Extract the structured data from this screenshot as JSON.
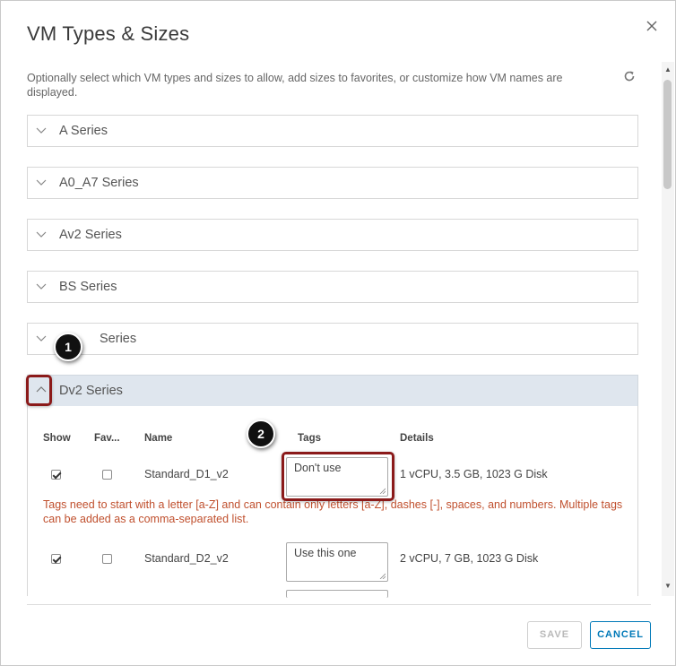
{
  "dialog": {
    "title": "VM Types & Sizes",
    "description": "Optionally select which VM types and sizes to allow, add sizes to favorites, or customize how VM names are displayed.",
    "close_icon": "close-icon",
    "refresh_icon": "refresh-icon"
  },
  "series": [
    {
      "label": "A Series",
      "expanded": false
    },
    {
      "label": "A0_A7 Series",
      "expanded": false
    },
    {
      "label": "Av2 Series",
      "expanded": false
    },
    {
      "label": "BS Series",
      "expanded": false
    },
    {
      "label": "Series",
      "expanded": false
    },
    {
      "label": "Dv2 Series",
      "expanded": true
    }
  ],
  "table": {
    "headers": {
      "show": "Show",
      "fav": "Fav...",
      "name": "Name",
      "tags": "Tags",
      "details": "Details"
    },
    "rows": [
      {
        "show": true,
        "fav": false,
        "name": "Standard_D1_v2",
        "tags": "Don't use",
        "details": "1 vCPU, 3.5 GB, 1023 G Disk"
      },
      {
        "show": true,
        "fav": false,
        "name": "Standard_D2_v2",
        "tags": "Use this one",
        "details": "2 vCPU, 7 GB, 1023 G Disk"
      }
    ],
    "error": "Tags need to start with a letter [a-Z] and can contain only letters [a-Z], dashes [-], spaces, and numbers. Multiple tags can be added as a comma-separated list."
  },
  "callouts": {
    "one": "1",
    "two": "2"
  },
  "footer": {
    "save_label": "SAVE",
    "cancel_label": "CANCEL"
  },
  "colors": {
    "accent": "#0079b8",
    "highlight": "#8b1a1a",
    "error": "#c0502e",
    "expanded_header": "#dfe6ee"
  }
}
